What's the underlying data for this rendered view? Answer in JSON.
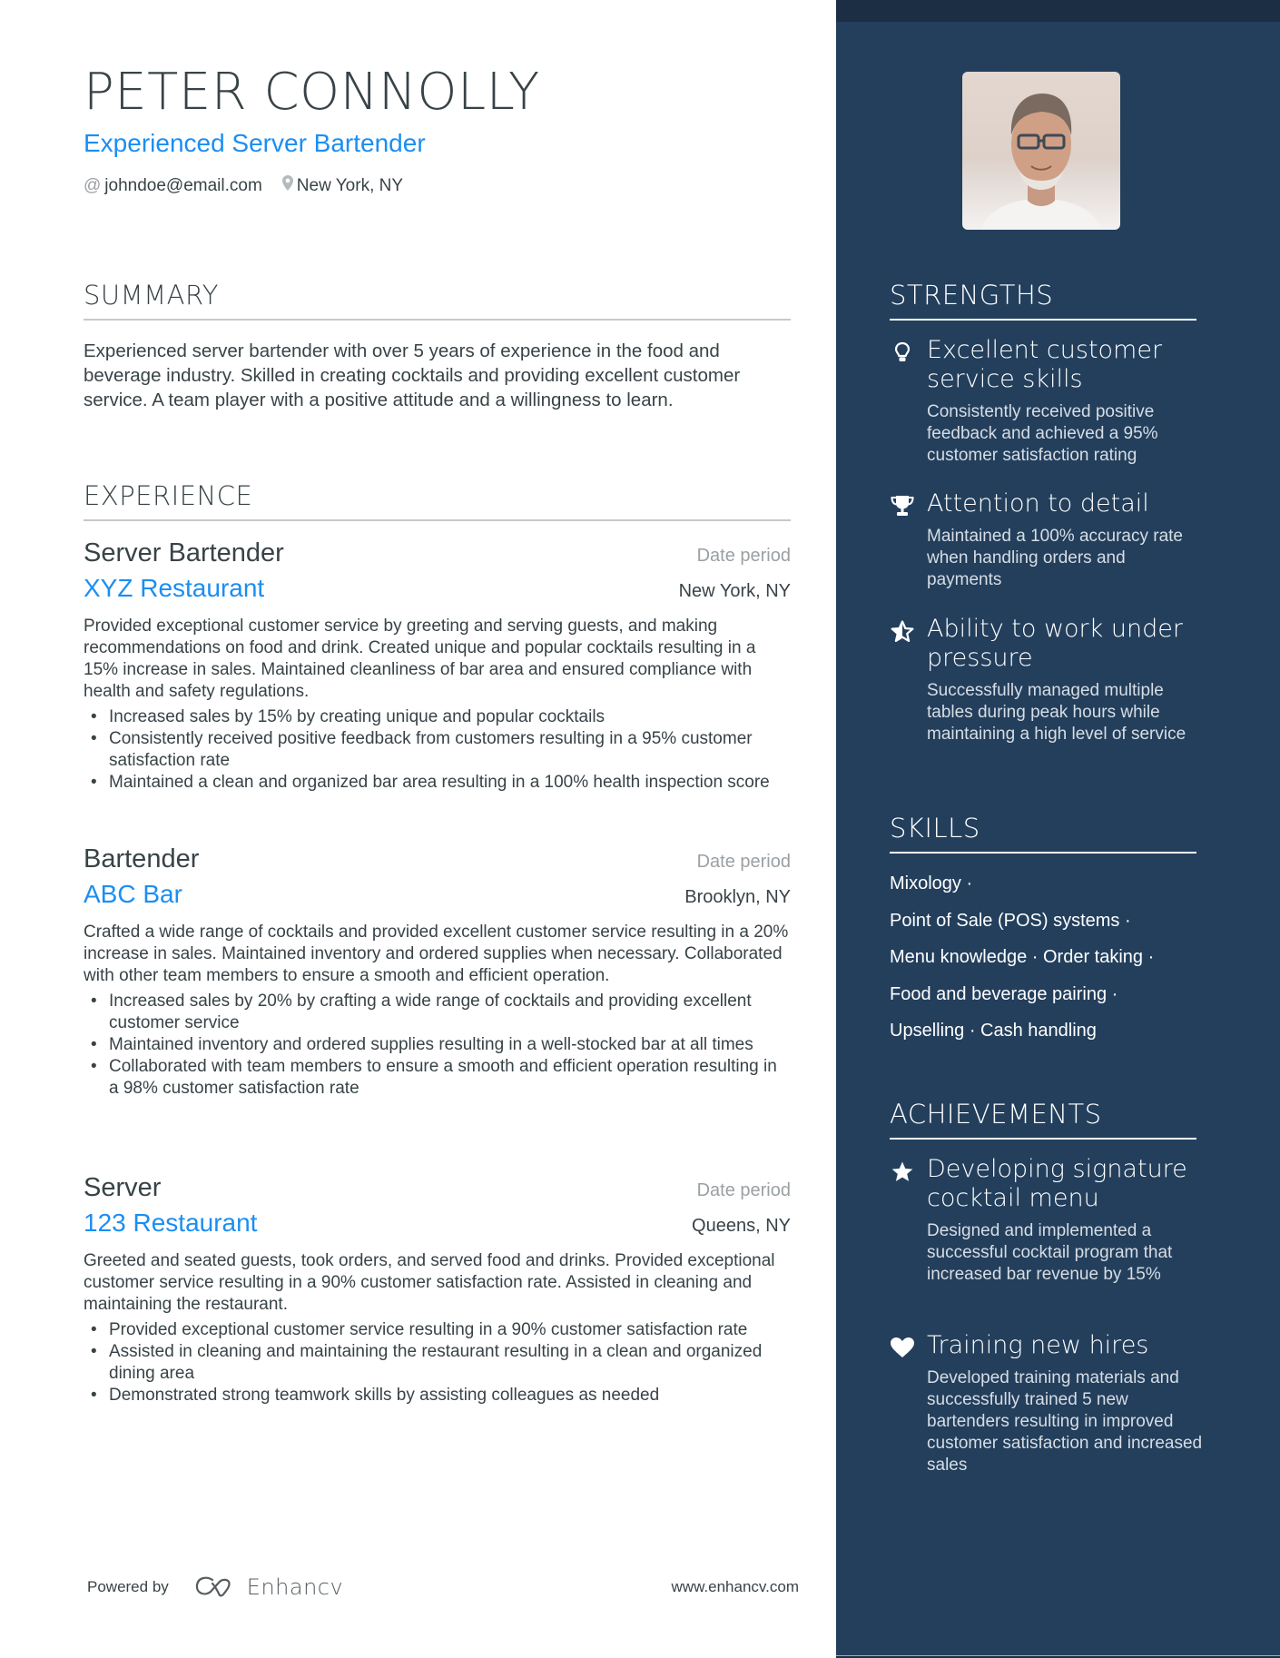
{
  "header": {
    "name": "PETER CONNOLLY",
    "headline": "Experienced Server Bartender",
    "contacts": [
      {
        "icon": "at-icon",
        "glyph": "@",
        "text": "johndoe@email.com"
      },
      {
        "icon": "location-pin-icon",
        "glyph": "⚲",
        "text": "New York, NY"
      }
    ]
  },
  "summary": {
    "title": "SUMMARY",
    "text": "Experienced server bartender with over 5 years of experience in the food and beverage industry. Skilled in creating cocktails and providing excellent customer service. A team player with a positive attitude and a willingness to learn."
  },
  "experience": {
    "title": "EXPERIENCE",
    "jobs": [
      {
        "title": "Server Bartender",
        "date": "Date period",
        "company": "XYZ Restaurant",
        "location": "New York, NY",
        "description": "Provided exceptional customer service by greeting and serving guests, and making recommendations on food and drink. Created unique and popular cocktails resulting in a 15% increase in sales. Maintained cleanliness of bar area and ensured compliance with health and safety regulations.",
        "bullets": [
          "Increased sales by 15% by creating unique and popular cocktails",
          "Consistently received positive feedback from customers resulting in a 95% customer satisfaction rate",
          "Maintained a clean and organized bar area resulting in a 100% health inspection score"
        ]
      },
      {
        "title": "Bartender",
        "date": "Date period",
        "company": "ABC Bar",
        "location": "Brooklyn, NY",
        "description": "Crafted a wide range of cocktails and provided excellent customer service resulting in a 20% increase in sales. Maintained inventory and ordered supplies when necessary. Collaborated with other team members to ensure a smooth and efficient operation.",
        "bullets": [
          "Increased sales by 20% by crafting a wide range of cocktails and providing excellent customer service",
          "Maintained inventory and ordered supplies resulting in a well-stocked bar at all times",
          "Collaborated with team members to ensure a smooth and efficient operation resulting in a 98% customer satisfaction rate"
        ]
      },
      {
        "title": "Server",
        "date": "Date period",
        "company": "123 Restaurant",
        "location": "Queens, NY",
        "description": "Greeted and seated guests, took orders, and served food and drinks. Provided exceptional customer service resulting in a 90% customer satisfaction rate. Assisted in cleaning and maintaining the restaurant.",
        "bullets": [
          "Provided exceptional customer service resulting in a 90% customer satisfaction rate",
          "Assisted in cleaning and maintaining the restaurant resulting in a clean and organized dining area",
          "Demonstrated strong teamwork skills by assisting colleagues as needed"
        ]
      }
    ]
  },
  "sidebar": {
    "photo_alt": "Profile photo",
    "strengths": {
      "title": "STRENGTHS",
      "items": [
        {
          "icon": "lightbulb-icon",
          "title": "Excellent customer service skills",
          "description": "Consistently received positive feedback and achieved a 95% customer satisfaction rating"
        },
        {
          "icon": "trophy-icon",
          "title": "Attention to detail",
          "description": "Maintained a 100% accuracy rate when handling orders and payments"
        },
        {
          "icon": "star-outline-icon",
          "title": "Ability to work under pressure",
          "description": "Successfully managed multiple tables during peak hours while maintaining a high level of service"
        }
      ]
    },
    "skills": {
      "title": "SKILLS",
      "lines": [
        "Mixology ·",
        "Point of Sale (POS) systems ·",
        "Menu knowledge · Order taking ·",
        "Food and beverage pairing ·",
        "Upselling · Cash handling"
      ]
    },
    "achievements": {
      "title": "ACHIEVEMENTS",
      "items": [
        {
          "icon": "star-icon",
          "title": "Developing signature cocktail menu",
          "description": "Designed and implemented a successful cocktail program that increased bar revenue by 15%"
        },
        {
          "icon": "heart-icon",
          "title": "Training new hires",
          "description": "Developed training materials and successfully trained 5 new bartenders resulting in improved customer satisfaction and increased sales"
        }
      ]
    }
  },
  "footer": {
    "powered_by": "Powered by",
    "brand": "Enhancv",
    "url": "www.enhancv.com"
  },
  "colors": {
    "accent": "#1b8ef2",
    "sidebar_bg": "#233f5c",
    "sidebar_top": "#1c2e44",
    "text": "#384347",
    "muted": "#9aa0a4"
  }
}
